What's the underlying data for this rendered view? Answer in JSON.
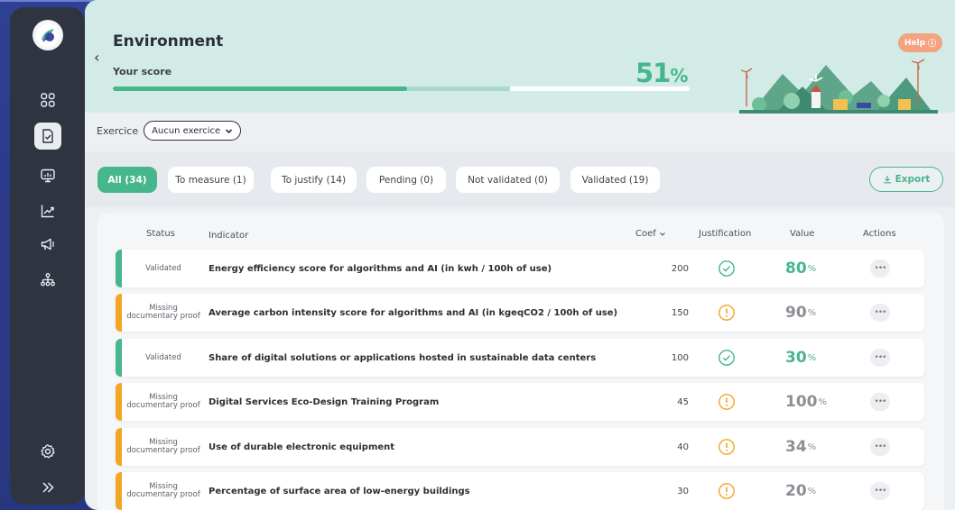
{
  "header": {
    "title": "Environment",
    "score_label": "Your score",
    "score_value": "51",
    "score_unit": "%",
    "help_label": "Help",
    "help_icon": "ⓘ"
  },
  "exercice": {
    "label": "Exercice",
    "selected": "Aucun exercice"
  },
  "filters": [
    {
      "label": "All (34)",
      "active": true
    },
    {
      "label": "To measure (1)",
      "active": false
    },
    {
      "label": "To justify (14)",
      "active": false
    },
    {
      "label": "Pending (0)",
      "active": false
    },
    {
      "label": "Not validated (0)",
      "active": false
    },
    {
      "label": "Validated (19)",
      "active": false
    }
  ],
  "export_label": "Export",
  "table": {
    "headers": {
      "status": "Status",
      "indicator": "Indicator",
      "coef": "Coef",
      "justification": "Justification",
      "value": "Value",
      "actions": "Actions"
    },
    "rows": [
      {
        "status": "Validated",
        "indicator": "Energy efficiency score for algorithms and AI (in kwh / 100h of use)",
        "coef": "200",
        "justification": "check",
        "value": "80",
        "unit": "%"
      },
      {
        "status_line1": "Missing",
        "status_line2": "documentary proof",
        "indicator": "Average carbon intensity score for algorithms and AI (in kgeqCO2 / 100h of use)",
        "coef": "150",
        "justification": "warning",
        "value": "90",
        "unit": "%"
      },
      {
        "status": "Validated",
        "indicator": "Share of digital solutions or applications hosted in sustainable data centers",
        "coef": "100",
        "justification": "check",
        "value": "30",
        "unit": "%"
      },
      {
        "status_line1": "Missing",
        "status_line2": "documentary proof",
        "indicator": "Digital Services Eco-Design Training Program",
        "coef": "45",
        "justification": "warning",
        "value": "100",
        "unit": "%"
      },
      {
        "status_line1": "Missing",
        "status_line2": "documentary proof",
        "indicator": "Use of durable electronic equipment",
        "coef": "40",
        "justification": "warning",
        "value": "34",
        "unit": "%"
      },
      {
        "status_line1": "Missing",
        "status_line2": "documentary proof",
        "indicator": "Percentage of surface area of low-energy buildings",
        "coef": "30",
        "justification": "warning",
        "value": "20",
        "unit": "%"
      }
    ]
  },
  "colors": {
    "green": "#46b68c",
    "orange": "#f2a623",
    "sidebar": "#2e3541",
    "header": "#d3ebe7"
  },
  "icons": {
    "sidebar": [
      "dashboard-icon",
      "document-check-icon",
      "presentation-chart-icon",
      "trend-chart-icon",
      "megaphone-icon",
      "org-chart-icon",
      "settings-icon",
      "expand-icon"
    ]
  }
}
